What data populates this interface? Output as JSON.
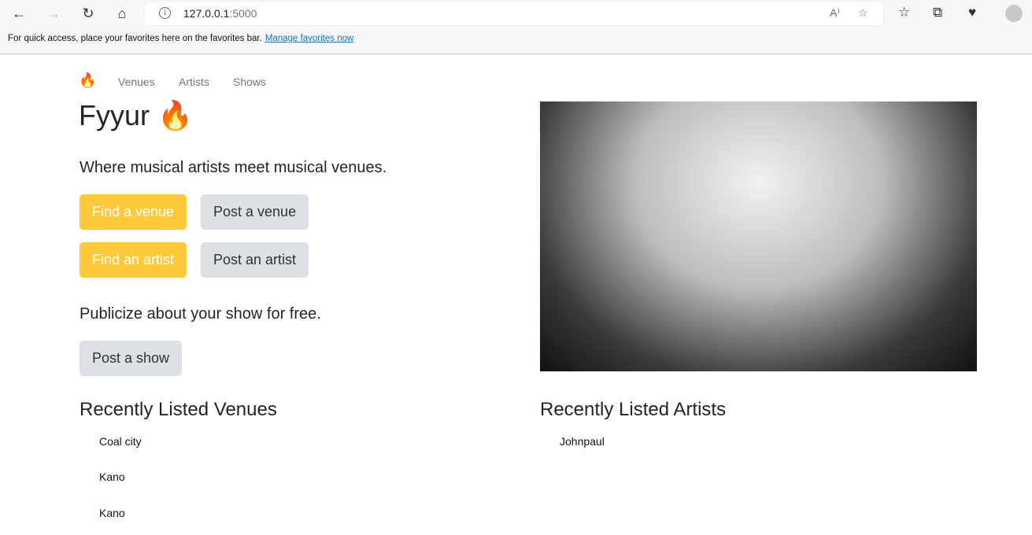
{
  "browser": {
    "url_host": "127.0.0.1",
    "url_port": ":5000",
    "favorites_text": "For quick access, place your favorites here on the favorites bar.",
    "favorites_link": "Manage favorites now"
  },
  "nav": {
    "logo": "🔥",
    "items": [
      "Venues",
      "Artists",
      "Shows"
    ]
  },
  "title": "Fyyur 🔥",
  "tagline": "Where musical artists meet musical venues.",
  "buttons": {
    "find_venue": "Find a venue",
    "post_venue": "Post a venue",
    "find_artist": "Find an artist",
    "post_artist": "Post an artist",
    "post_show": "Post a show"
  },
  "publicize": "Publicize about your show for free.",
  "venues": {
    "heading": "Recently Listed Venues",
    "items": [
      "Coal city",
      "Kano",
      "Kano"
    ]
  },
  "artists": {
    "heading": "Recently Listed Artists",
    "items": [
      "Johnpaul"
    ]
  }
}
